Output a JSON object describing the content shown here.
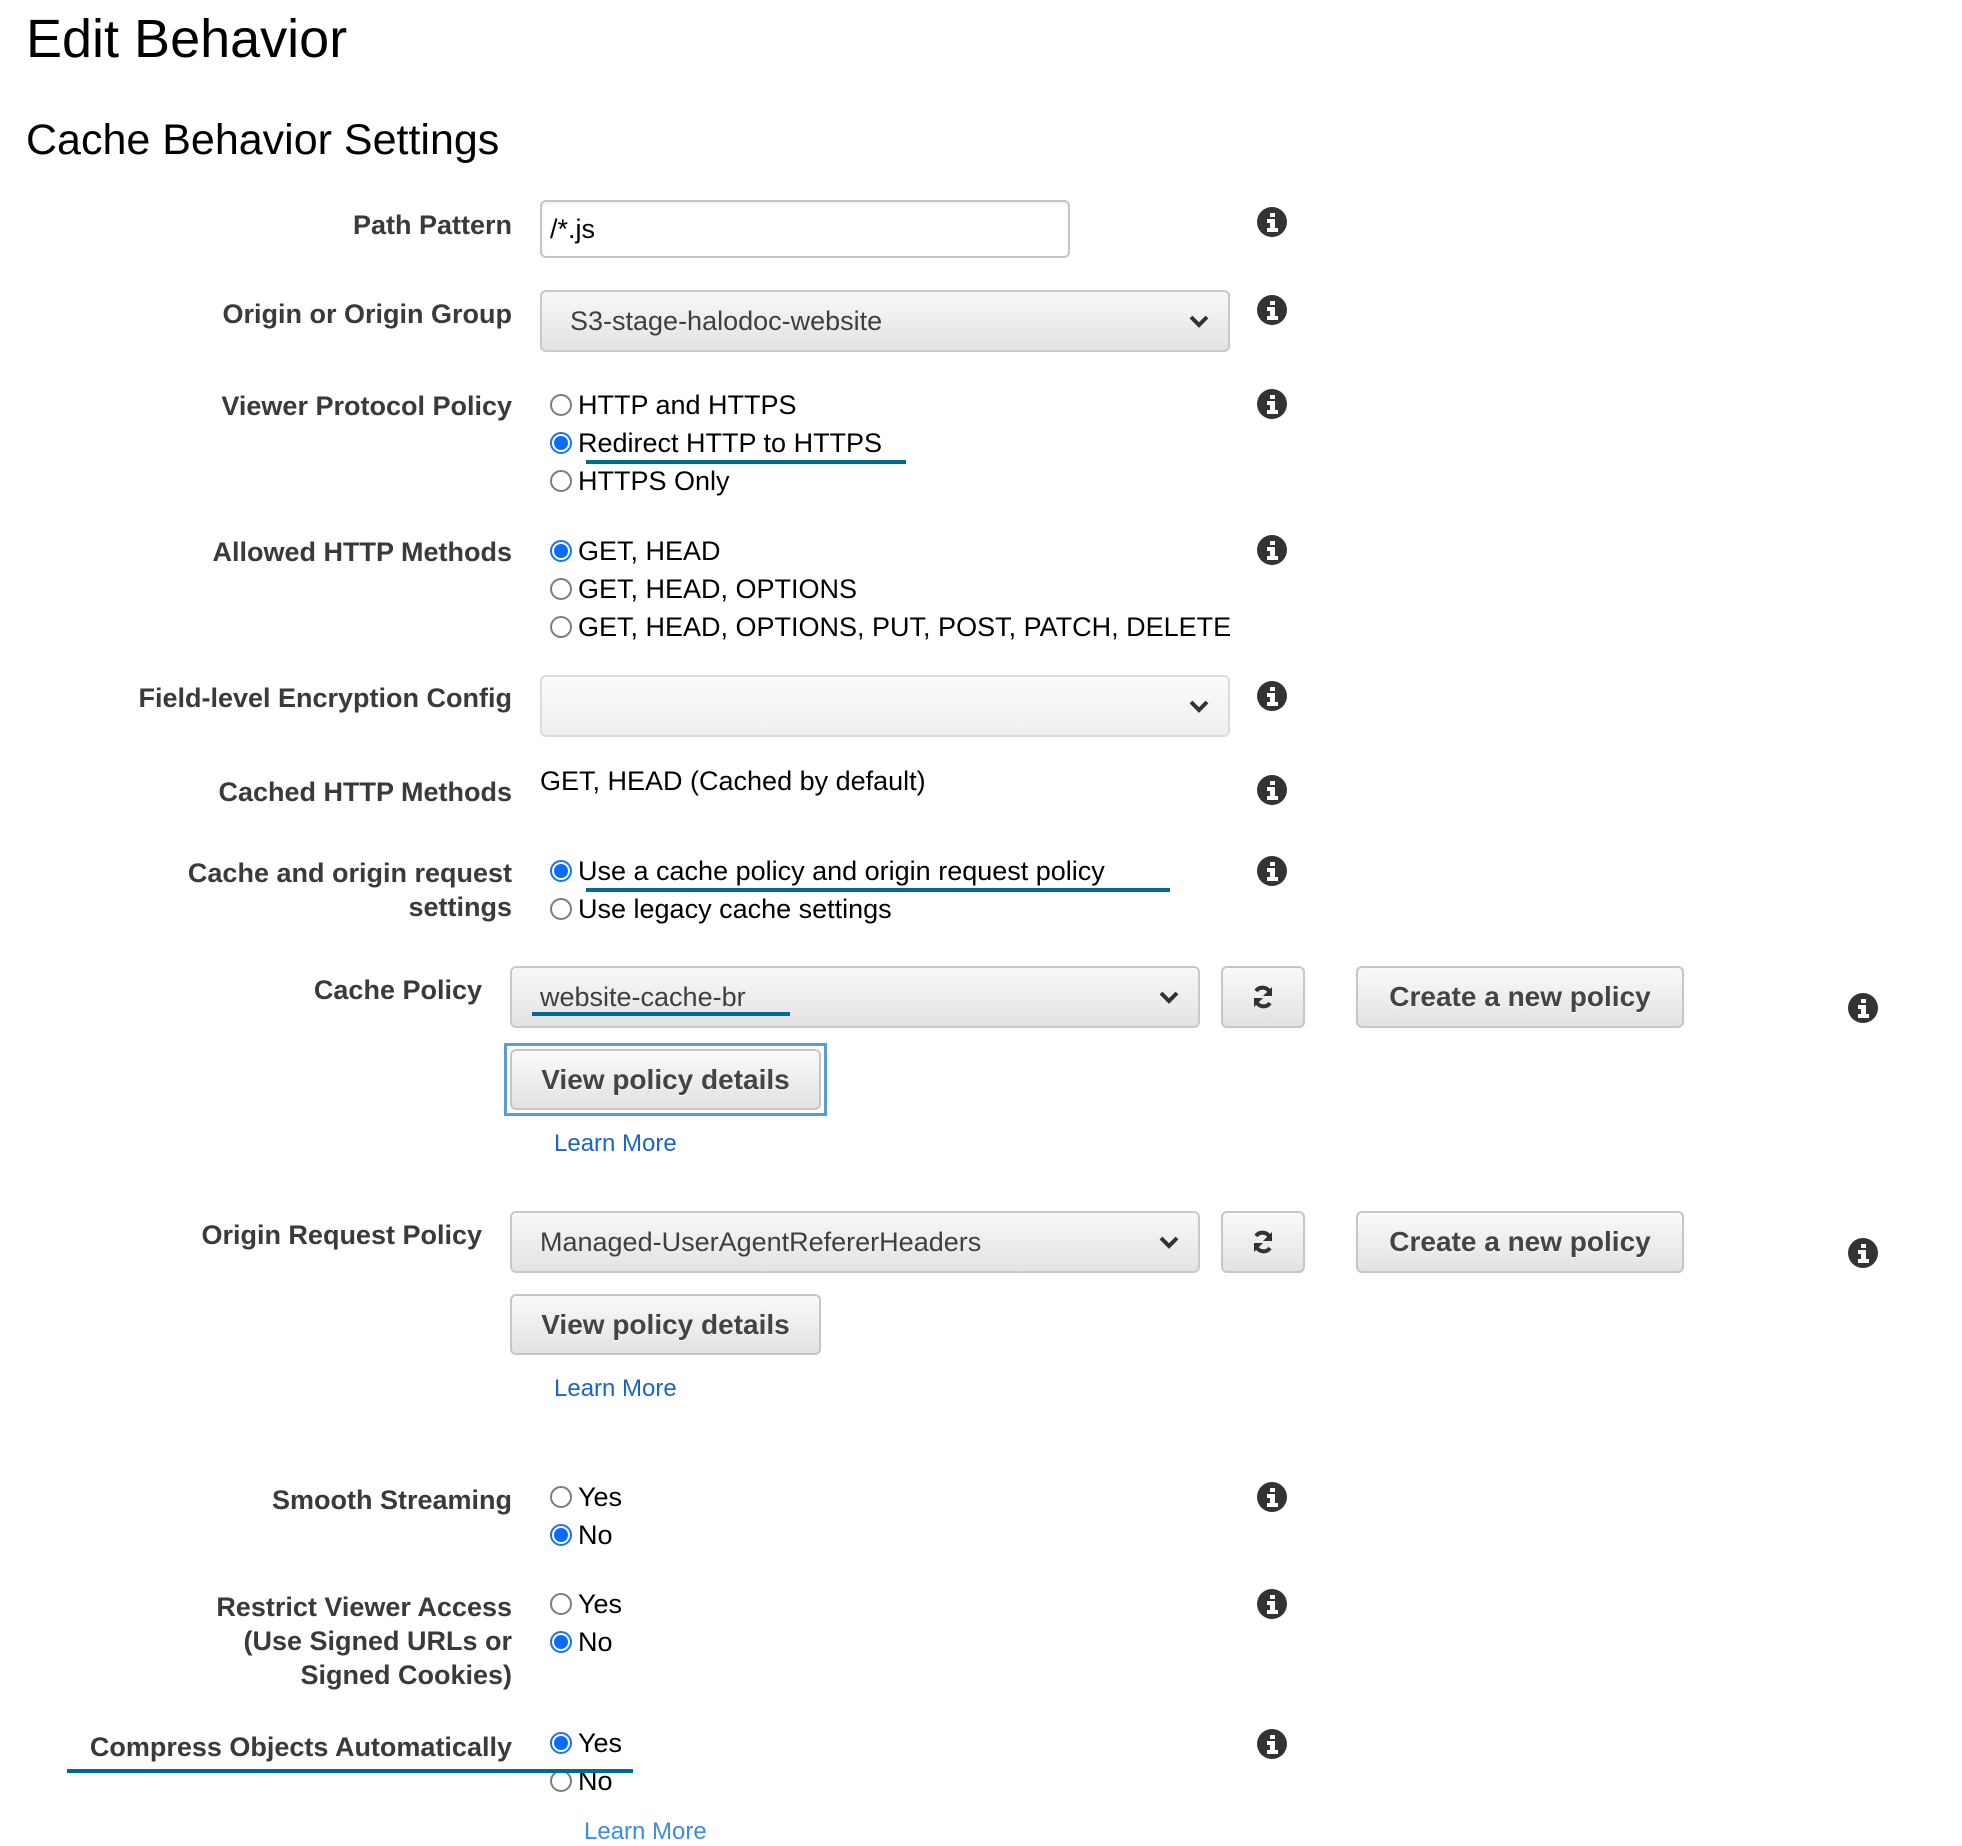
{
  "page": {
    "title": "Edit Behavior",
    "section_title": "Cache Behavior Settings"
  },
  "colors": {
    "annotation_underline": "#006b8f",
    "radio_selected": "#0a6cff",
    "link": "#1a66c0",
    "focus_ring": "#5b9bd5"
  },
  "path_pattern": {
    "label": "Path Pattern",
    "value": "/*.js"
  },
  "origin": {
    "label": "Origin or Origin Group",
    "selected": "S3-stage-halodoc-website"
  },
  "viewer_protocol": {
    "label": "Viewer Protocol Policy",
    "options": [
      {
        "label": "HTTP and HTTPS",
        "checked": false
      },
      {
        "label": "Redirect HTTP to HTTPS",
        "checked": true
      },
      {
        "label": "HTTPS Only",
        "checked": false
      }
    ]
  },
  "allowed_methods": {
    "label": "Allowed HTTP Methods",
    "options": [
      {
        "label": "GET, HEAD",
        "checked": true
      },
      {
        "label": "GET, HEAD, OPTIONS",
        "checked": false
      },
      {
        "label": "GET, HEAD, OPTIONS, PUT, POST, PATCH, DELETE",
        "checked": false
      }
    ]
  },
  "field_level_encryption": {
    "label": "Field-level Encryption Config",
    "selected": ""
  },
  "cached_methods": {
    "label": "Cached HTTP Methods",
    "value": "GET, HEAD (Cached by default)"
  },
  "cache_origin_settings": {
    "label_line1": "Cache and origin request",
    "label_line2": "settings",
    "options": [
      {
        "label": "Use a cache policy and origin request policy",
        "checked": true
      },
      {
        "label": "Use legacy cache settings",
        "checked": false
      }
    ]
  },
  "cache_policy": {
    "label": "Cache Policy",
    "selected": "website-cache-br",
    "create_label": "Create a new policy",
    "view_label": "View policy details",
    "learn_more": "Learn More"
  },
  "origin_request_policy": {
    "label": "Origin Request Policy",
    "selected": "Managed-UserAgentRefererHeaders",
    "create_label": "Create a new policy",
    "view_label": "View policy details",
    "learn_more": "Learn More"
  },
  "smooth_streaming": {
    "label": "Smooth Streaming",
    "options": [
      {
        "label": "Yes",
        "checked": false
      },
      {
        "label": "No",
        "checked": true
      }
    ]
  },
  "restrict_viewer_access": {
    "label_line1": "Restrict Viewer Access",
    "label_line2": "(Use Signed URLs or",
    "label_line3": "Signed Cookies)",
    "options": [
      {
        "label": "Yes",
        "checked": false
      },
      {
        "label": "No",
        "checked": true
      }
    ]
  },
  "compress_objects": {
    "label": "Compress Objects Automatically",
    "options": [
      {
        "label": "Yes",
        "checked": true
      },
      {
        "label": "No",
        "checked": false
      }
    ],
    "learn_more": "Learn More"
  },
  "icons": {
    "info": "info-circle-icon",
    "chevron": "chevron-down-icon",
    "refresh": "refresh-icon"
  }
}
